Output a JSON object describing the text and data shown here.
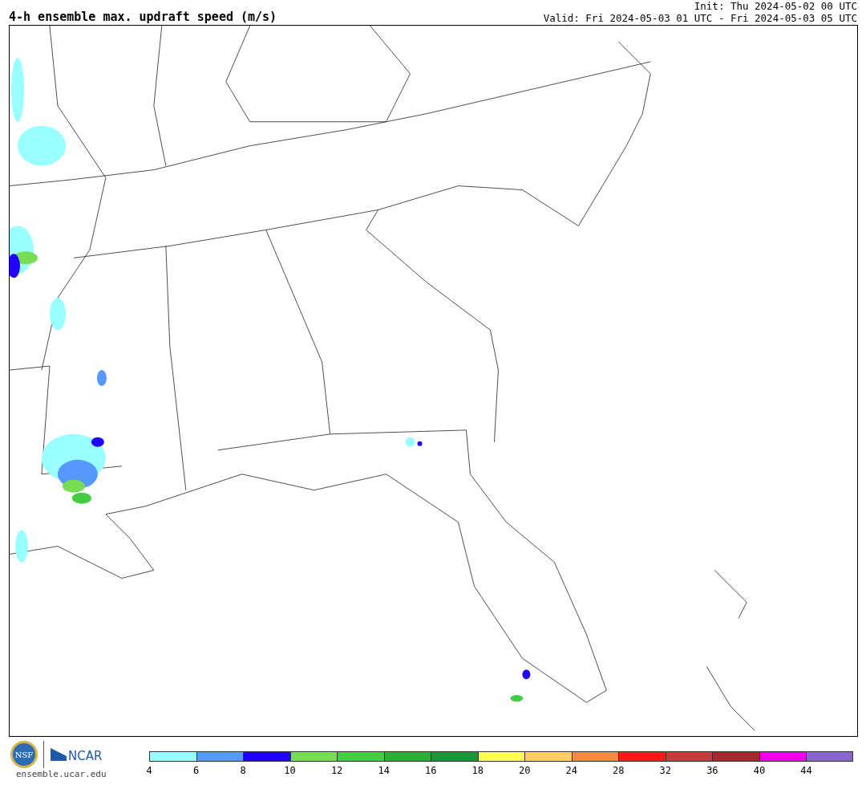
{
  "title": "4-h ensemble max. updraft speed (m/s)",
  "init": "Init: Thu 2024-05-02 00 UTC",
  "valid": "Valid: Fri 2024-05-03 01 UTC - Fri 2024-05-03 05 UTC",
  "logos": {
    "nsf": "NSF",
    "ncar": "NCAR",
    "url": "ensemble.ucar.edu"
  },
  "colorbar": [
    {
      "label": "4",
      "color": "#99ffff"
    },
    {
      "label": "6",
      "color": "#5599ff"
    },
    {
      "label": "8",
      "color": "#2200ff"
    },
    {
      "label": "10",
      "color": "#77dd55"
    },
    {
      "label": "12",
      "color": "#44cc44"
    },
    {
      "label": "14",
      "color": "#2fad35"
    },
    {
      "label": "16",
      "color": "#1f9636"
    },
    {
      "label": "18",
      "color": "#ffff55"
    },
    {
      "label": "20",
      "color": "#ffcc66"
    },
    {
      "label": "24",
      "color": "#ff8844"
    },
    {
      "label": "28",
      "color": "#ff1a1a"
    },
    {
      "label": "32",
      "color": "#cc3b3b"
    },
    {
      "label": "36",
      "color": "#a32b2b"
    },
    {
      "label": "40",
      "color": "#ee00ee"
    },
    {
      "label": "44",
      "color": "#8866cc"
    }
  ]
}
